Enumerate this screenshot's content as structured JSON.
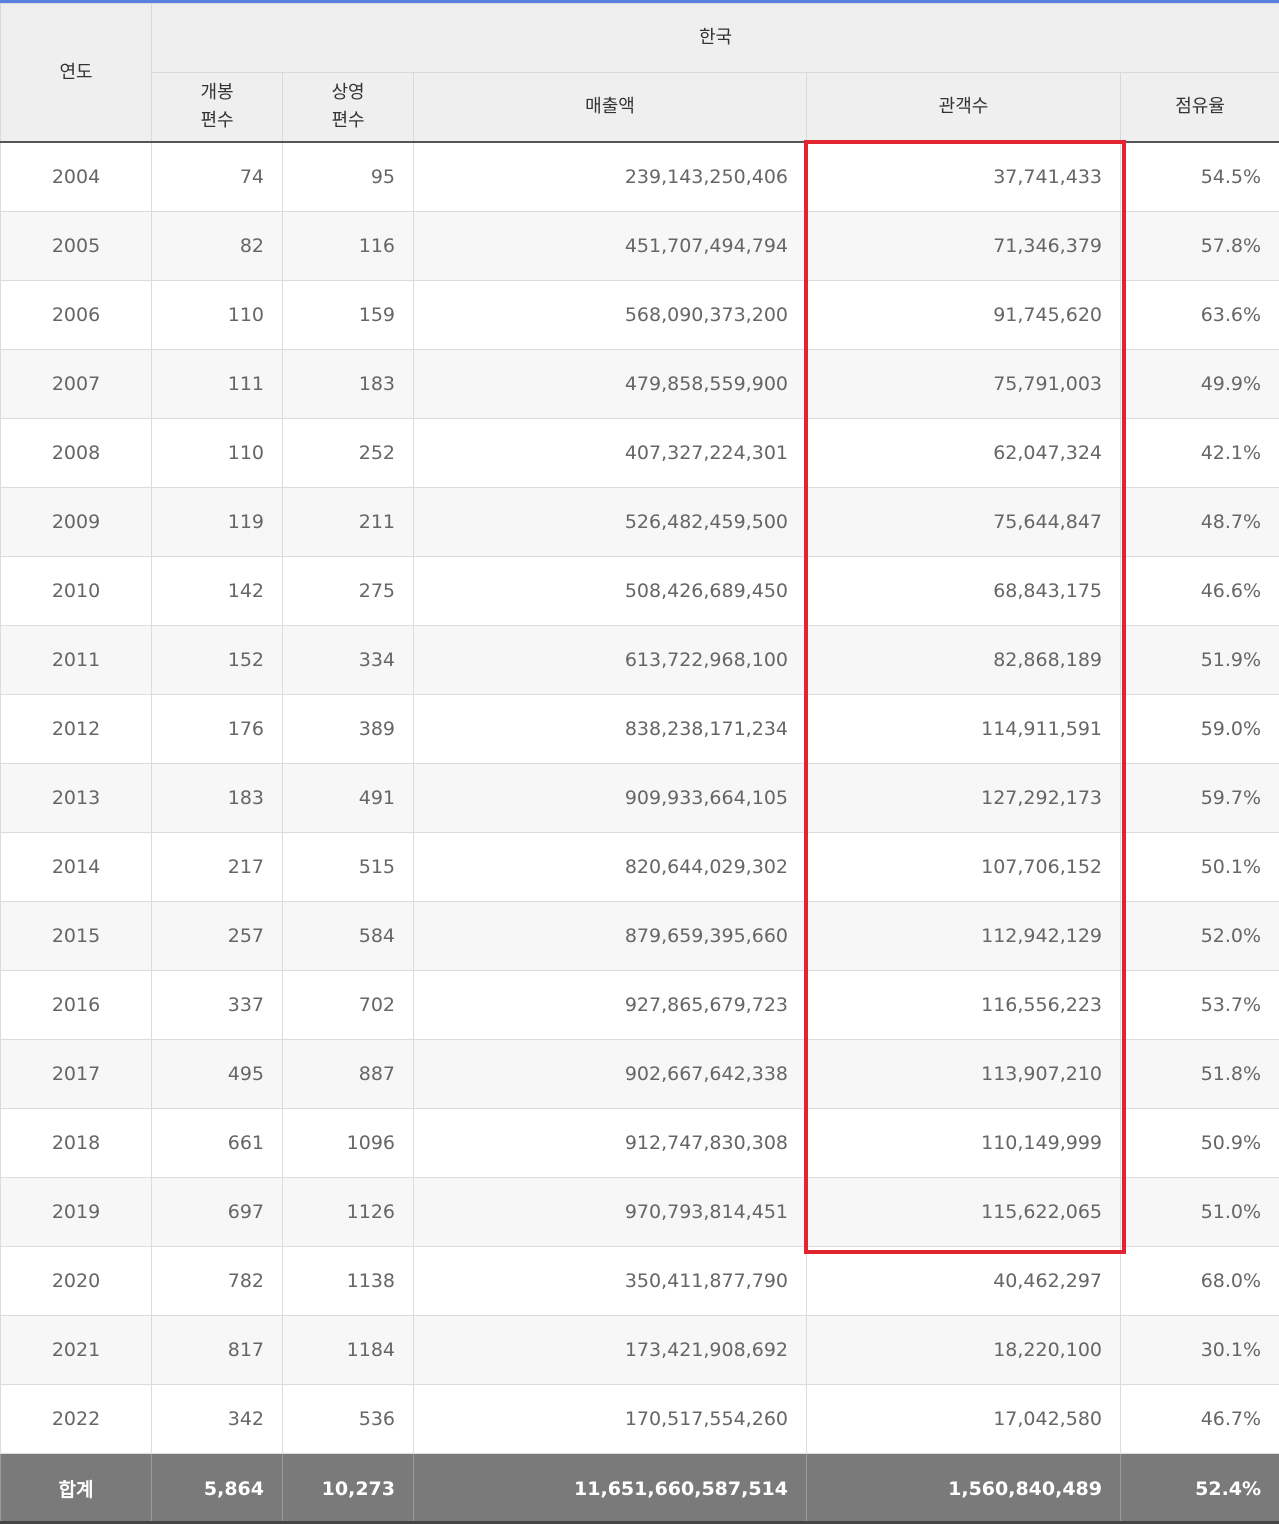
{
  "header": {
    "year": "연도",
    "group": "한국",
    "open_line1": "개봉",
    "open_line2": "편수",
    "screen_line1": "상영",
    "screen_line2": "편수",
    "sales": "매출액",
    "audience": "관객수",
    "share": "점유율"
  },
  "rows": [
    {
      "year": "2004",
      "open": "74",
      "screen": "95",
      "sales": "239,143,250,406",
      "audience": "37,741,433",
      "share": "54.5%"
    },
    {
      "year": "2005",
      "open": "82",
      "screen": "116",
      "sales": "451,707,494,794",
      "audience": "71,346,379",
      "share": "57.8%"
    },
    {
      "year": "2006",
      "open": "110",
      "screen": "159",
      "sales": "568,090,373,200",
      "audience": "91,745,620",
      "share": "63.6%"
    },
    {
      "year": "2007",
      "open": "111",
      "screen": "183",
      "sales": "479,858,559,900",
      "audience": "75,791,003",
      "share": "49.9%"
    },
    {
      "year": "2008",
      "open": "110",
      "screen": "252",
      "sales": "407,327,224,301",
      "audience": "62,047,324",
      "share": "42.1%"
    },
    {
      "year": "2009",
      "open": "119",
      "screen": "211",
      "sales": "526,482,459,500",
      "audience": "75,644,847",
      "share": "48.7%"
    },
    {
      "year": "2010",
      "open": "142",
      "screen": "275",
      "sales": "508,426,689,450",
      "audience": "68,843,175",
      "share": "46.6%"
    },
    {
      "year": "2011",
      "open": "152",
      "screen": "334",
      "sales": "613,722,968,100",
      "audience": "82,868,189",
      "share": "51.9%"
    },
    {
      "year": "2012",
      "open": "176",
      "screen": "389",
      "sales": "838,238,171,234",
      "audience": "114,911,591",
      "share": "59.0%"
    },
    {
      "year": "2013",
      "open": "183",
      "screen": "491",
      "sales": "909,933,664,105",
      "audience": "127,292,173",
      "share": "59.7%"
    },
    {
      "year": "2014",
      "open": "217",
      "screen": "515",
      "sales": "820,644,029,302",
      "audience": "107,706,152",
      "share": "50.1%"
    },
    {
      "year": "2015",
      "open": "257",
      "screen": "584",
      "sales": "879,659,395,660",
      "audience": "112,942,129",
      "share": "52.0%"
    },
    {
      "year": "2016",
      "open": "337",
      "screen": "702",
      "sales": "927,865,679,723",
      "audience": "116,556,223",
      "share": "53.7%"
    },
    {
      "year": "2017",
      "open": "495",
      "screen": "887",
      "sales": "902,667,642,338",
      "audience": "113,907,210",
      "share": "51.8%"
    },
    {
      "year": "2018",
      "open": "661",
      "screen": "1096",
      "sales": "912,747,830,308",
      "audience": "110,149,999",
      "share": "50.9%"
    },
    {
      "year": "2019",
      "open": "697",
      "screen": "1126",
      "sales": "970,793,814,451",
      "audience": "115,622,065",
      "share": "51.0%"
    },
    {
      "year": "2020",
      "open": "782",
      "screen": "1138",
      "sales": "350,411,877,790",
      "audience": "40,462,297",
      "share": "68.0%"
    },
    {
      "year": "2021",
      "open": "817",
      "screen": "1184",
      "sales": "173,421,908,692",
      "audience": "18,220,100",
      "share": "30.1%"
    },
    {
      "year": "2022",
      "open": "342",
      "screen": "536",
      "sales": "170,517,554,260",
      "audience": "17,042,580",
      "share": "46.7%"
    }
  ],
  "total": {
    "year": "합계",
    "open": "5,864",
    "screen": "10,273",
    "sales": "11,651,660,587,514",
    "audience": "1,560,840,489",
    "share": "52.4%"
  },
  "colors": {
    "highlight": "#e12430",
    "header_bg": "#efefef",
    "total_bg": "#7a7a7a",
    "top_accent": "#5b7fe0"
  }
}
